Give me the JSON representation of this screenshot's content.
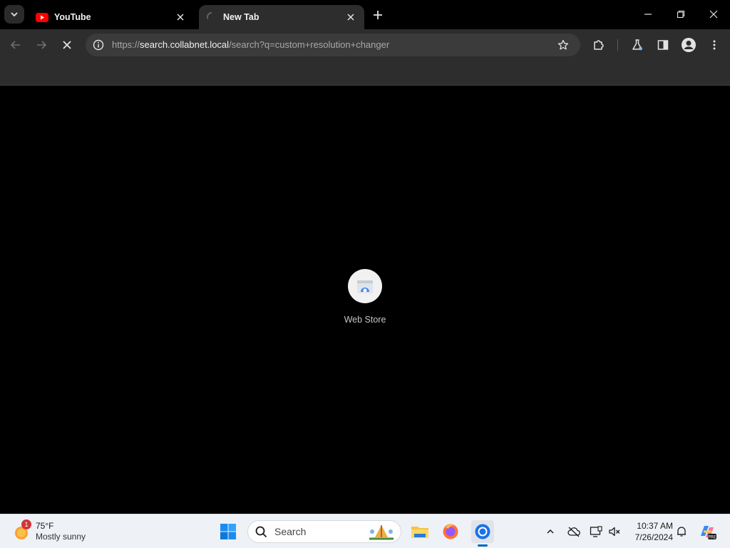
{
  "browser": {
    "tabs": [
      {
        "title": "YouTube",
        "favicon": "youtube-icon",
        "active": false
      },
      {
        "title": "New Tab",
        "favicon": "loading-spinner-icon",
        "active": true
      }
    ],
    "address_bar": {
      "url_scheme": "https://",
      "url_host": "search.collabnet.local",
      "url_path": "/search?q=custom+resolution+changer"
    },
    "accent_color": "#8ab4f8"
  },
  "new_tab_page": {
    "shortcuts": [
      {
        "label": "Web Store",
        "icon": "web-store-icon"
      }
    ]
  },
  "taskbar": {
    "weather": {
      "badge": "1",
      "temperature": "75°F",
      "condition": "Mostly sunny"
    },
    "search_placeholder": "Search",
    "clock": {
      "time": "10:37 AM",
      "date": "7/26/2024"
    },
    "pinned_apps": [
      "windows-start-icon",
      "file-explorer-icon",
      "firefox-icon",
      "chrome-icon"
    ]
  }
}
